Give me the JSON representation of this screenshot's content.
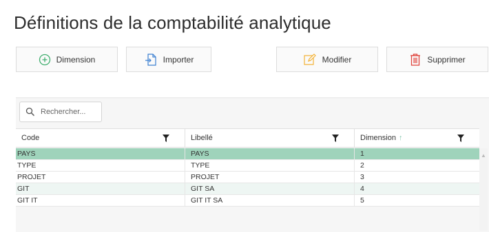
{
  "page": {
    "title": "Définitions de la comptabilité analytique"
  },
  "toolbar": {
    "dimension_label": "Dimension",
    "import_label": "Importer",
    "edit_label": "Modifier",
    "delete_label": "Supprimer"
  },
  "search": {
    "placeholder": "Rechercher..."
  },
  "grid": {
    "columns": [
      {
        "label": "Code"
      },
      {
        "label": "Libellé"
      },
      {
        "label": "Dimension",
        "sort": "ascending"
      }
    ],
    "rows": [
      {
        "code": "PAYS",
        "libelle": "PAYS",
        "dimension": "1",
        "selected": true
      },
      {
        "code": "TYPE",
        "libelle": "TYPE",
        "dimension": "2"
      },
      {
        "code": "PROJET",
        "libelle": "PROJET",
        "dimension": "3"
      },
      {
        "code": "GIT",
        "libelle": "GIT SA",
        "dimension": "4"
      },
      {
        "code": "GIT IT",
        "libelle": "GIT IT SA",
        "dimension": "5"
      }
    ]
  },
  "colors": {
    "selected_row": "#9fd3bb",
    "alt_row": "#eef6f3",
    "add_icon": "#3fae6e",
    "import_icon": "#3b7fd1",
    "edit_icon": "#f2b134",
    "delete_icon": "#e0453d"
  }
}
